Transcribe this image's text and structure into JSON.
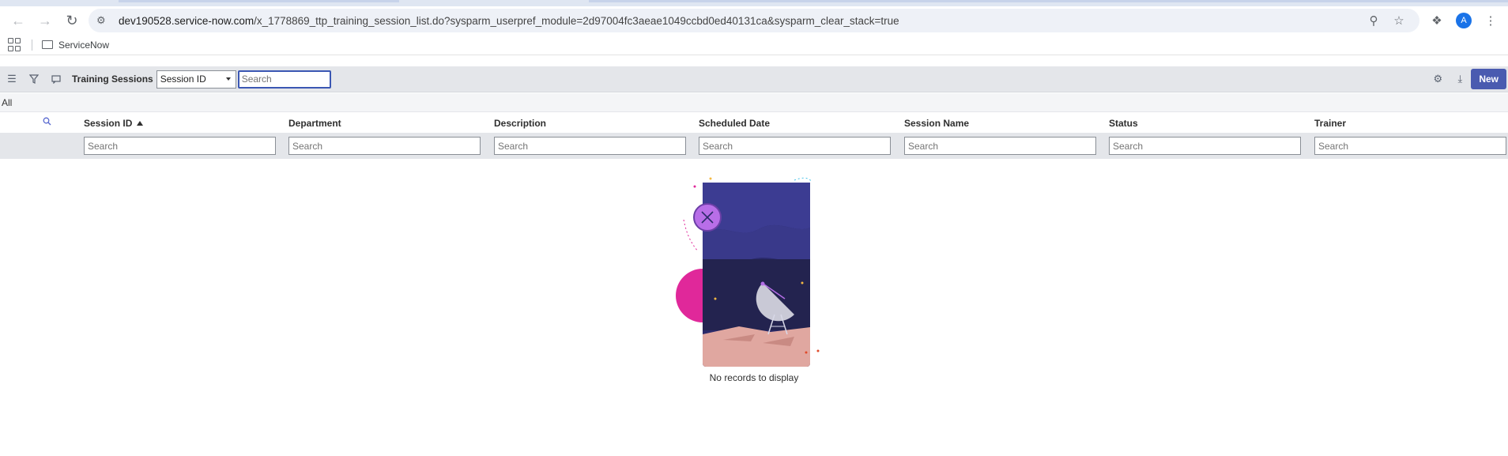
{
  "browser": {
    "url_host": "dev190528.service-now.com",
    "url_path": "/x_1778869_ttp_training_session_list.do?sysparm_userpref_module=2d97004fc3aeae1049ccbd0ed40131ca&sysparm_clear_stack=true",
    "avatar_letter": "A",
    "bookmark": "ServiceNow"
  },
  "list": {
    "title": "Training Sessions",
    "search_field": "Session ID",
    "search_placeholder": "Search",
    "new_label": "New",
    "breadcrumb": "All"
  },
  "columns": [
    {
      "label": "Session ID",
      "sorted": "asc"
    },
    {
      "label": "Department"
    },
    {
      "label": "Description"
    },
    {
      "label": "Scheduled Date"
    },
    {
      "label": "Session Name"
    },
    {
      "label": "Status"
    },
    {
      "label": "Trainer"
    }
  ],
  "filter_placeholder": "Search",
  "empty_message": "No records to display",
  "colors": {
    "accent": "#4a5bb0",
    "header_bg": "#e4e6ea"
  },
  "icons": [
    "back-icon",
    "forward-icon",
    "reload-icon",
    "site-info-icon",
    "zoom-icon",
    "star-icon",
    "extensions-icon",
    "menu-icon",
    "apps-icon",
    "folder-icon",
    "hamburger-icon",
    "filter-icon",
    "message-icon",
    "gear-icon",
    "download-icon",
    "search-icon"
  ]
}
